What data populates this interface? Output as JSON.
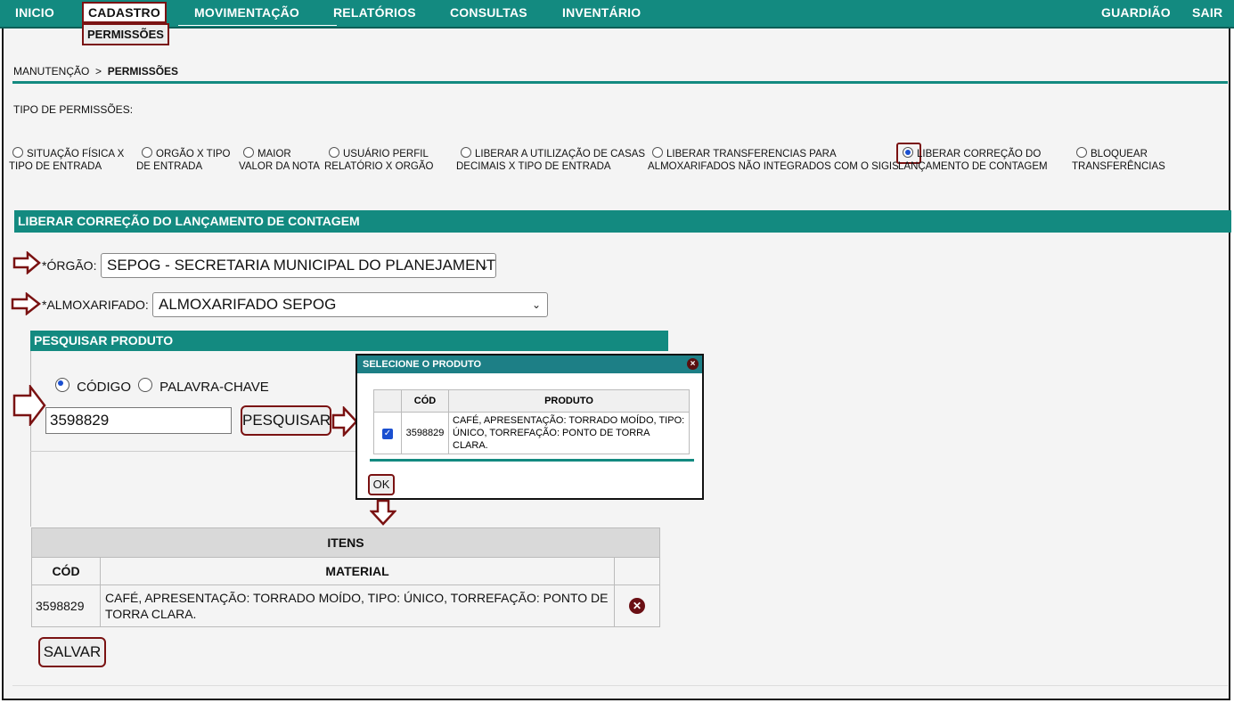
{
  "nav": {
    "items": [
      "INICIO",
      "CADASTRO",
      "MOVIMENTAÇÃO",
      "RELATÓRIOS",
      "CONSULTAS",
      "INVENTÁRIO"
    ],
    "right": [
      "GUARDIÃO",
      "SAIR"
    ],
    "submenu": "PERMISSÕES"
  },
  "breadcrumb": {
    "parent": "MANUTENÇÃO",
    "sep": ">",
    "current": "PERMISSÕES"
  },
  "permission_type_label": "TIPO DE PERMISSÕES:",
  "permission_options": [
    {
      "line1": "SITUAÇÃO FÍSICA X",
      "line2": "TIPO DE ENTRADA",
      "selected": false
    },
    {
      "line1": "ORGÃO X TIPO",
      "line2": "DE ENTRADA",
      "selected": false
    },
    {
      "line1": "MAIOR",
      "line2": "VALOR DA NOTA",
      "selected": false
    },
    {
      "line1": "USUÁRIO PERFIL",
      "line2": "RELATÓRIO X ORGÃO",
      "selected": false
    },
    {
      "line1": "LIBERAR A UTILIZAÇÃO DE CASAS",
      "line2": "DECIMAIS X TIPO DE ENTRADA",
      "selected": false
    },
    {
      "line1": "LIBERAR TRANSFERENCIAS PARA",
      "line2": "ALMOXARIFADOS NÃO INTEGRADOS COM O SIGIS",
      "selected": false
    },
    {
      "line1": "LIBERAR CORREÇÃO DO",
      "line2": "LANÇAMENTO DE CONTAGEM",
      "selected": true
    },
    {
      "line1": "BLOQUEAR",
      "line2": "TRANSFERÊNCIAS",
      "selected": false
    }
  ],
  "section_title": "LIBERAR CORREÇÃO DO LANÇAMENTO DE CONTAGEM",
  "orgao": {
    "label": "*ÓRGÃO:",
    "value": "SEPOG - SECRETARIA MUNICIPAL DO PLANEJAMENTO,"
  },
  "almoxarifado": {
    "label": "*ALMOXARIFADO:",
    "value": "ALMOXARIFADO SEPOG"
  },
  "search_panel": {
    "title": "PESQUISAR PRODUTO",
    "radio_code": "CÓDIGO",
    "radio_keyword": "PALAVRA-CHAVE",
    "input_value": "3598829",
    "search_button": "PESQUISAR"
  },
  "modal": {
    "title": "SELECIONE O PRODUTO",
    "close": "×",
    "headers": [
      "CÓD",
      "PRODUTO"
    ],
    "rows": [
      {
        "checked": true,
        "cod": "3598829",
        "produto": "CAFÉ, APRESENTAÇÃO: TORRADO MOÍDO, TIPO: ÚNICO, TORREFAÇÃO: PONTO DE TORRA CLARA."
      }
    ],
    "ok_button": "OK"
  },
  "items_table": {
    "title": "ITENS",
    "headers": [
      "CÓD",
      "MATERIAL"
    ],
    "rows": [
      {
        "cod": "3598829",
        "material": "CAFÉ, APRESENTAÇÃO: TORRADO MOÍDO, TIPO: ÚNICO, TORREFAÇÃO: PONTO DE TORRA CLARA."
      }
    ]
  },
  "save_button": "SALVAR",
  "colors": {
    "teal": "#138a80",
    "highlight_red": "#7a1212",
    "radio_blue": "#1a4fd0"
  }
}
